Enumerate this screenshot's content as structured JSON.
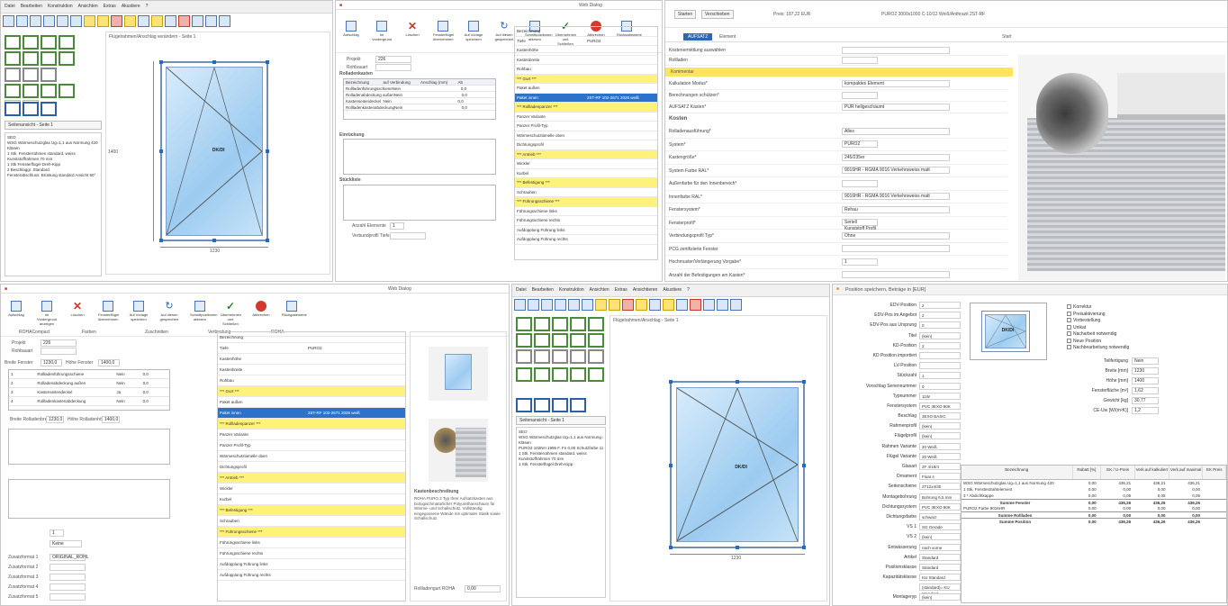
{
  "p1": {
    "menu": [
      "Datei",
      "Bearbeiten",
      "Konstruktion",
      "Ansichten",
      "Extras",
      "Akustiere",
      "?"
    ],
    "preview_caption": "Flügelrahmen/Anschlag verändern - Seite 1",
    "element_label": "DK/DI",
    "nav_label": "Seitenansicht - Seite 1",
    "notes": [
      "SEO",
      "WSG Wärmeschutzglas Ug=1,1 aus Normung 420",
      "Kläsen",
      "1 Stk. Fensterrahmen standard, weiss",
      "Kunststoffrahmen 70 mm",
      "1 Stk Fensterflügel Dreh-Kipp",
      "2 Beschlaggr. Standard",
      "Fensterabschluss: Brüstung standard Ansicht 90°"
    ],
    "dimension_width": "1230",
    "dimension_height": "1400",
    "status_text": "Ohne Vorschau"
  },
  "p2": {
    "title": "Web Dialog",
    "ribbon": [
      "Aufschlag",
      "Im Vordergrund",
      "Löschen",
      "Fensterflügel übernehmen",
      "Auf Vorlage speichern",
      "Auf diesen gespeichert",
      "Schnittpositionen ablesen",
      "Übernehmen und Schließen",
      "Abbrechen",
      "Rückgabewerte"
    ],
    "fields": [
      {
        "label": "Projekt",
        "value": "226"
      },
      {
        "label": "Rohbauart",
        "value": ""
      }
    ],
    "section_rolladen": "Rolladenkasten",
    "table_headers": [
      "Bezeichnung",
      "auf Verbindung",
      "Anschlag (mm)",
      "Ab"
    ],
    "table_rows": [
      [
        "Rollladenführungsschiene",
        "Nein",
        "",
        "0,0"
      ],
      [
        "Rolladenabdeckung außen",
        "Nein",
        "",
        "0,0"
      ],
      [
        "Kastenseitendeckel",
        "Nein",
        "",
        "0,0"
      ],
      [
        "Rollladenkastenabdeckung",
        "Nein",
        "",
        "0,0"
      ]
    ],
    "section_einrueckung": "Einrückung",
    "section_stueckliste": "Stückliste",
    "anzahl_label": "Anzahl Elemente",
    "anzahl_value": "1",
    "profile_label": "Verbundprofil Tiefe",
    "prop_rows": [
      "Bezeichnung",
      "Tiefe",
      "Kastenhöhe",
      "Kastenbreite",
      "Rohbau",
      "*** Gurt ***",
      "Paket außen",
      "Paket innen",
      "*** Rollladenpanzer ***",
      "Panzer Variante",
      "Panzer Profil-Typ",
      "Wärmeschutzlamelle oben",
      "Dichtungsprofil",
      "*** Antrieb ***",
      "Wickler",
      "Kurbel",
      "*** Befestigung ***",
      "Schrauben",
      "*** Führungsschiene ***",
      "Führungsschiene links",
      "Führungsschiene rechts",
      "Aufdopplung Führung links",
      "Aufdopplung Führung rechts"
    ],
    "prop_values": [
      "",
      "PURO2",
      "",
      "",
      "",
      "",
      "",
      "2ST-RF 102-2671 2026 weiß",
      "",
      "",
      "",
      "",
      "",
      "",
      "",
      "",
      "",
      "",
      "",
      "",
      "",
      "",
      ""
    ]
  },
  "p3": {
    "toolbar": [
      "Starten",
      "Verschieben",
      "Preis: 187,22 EUR"
    ],
    "header_info": "PURO2 3000x1000 C-10/12 Weiß/Anthrazit 2ST-RF",
    "tabs": [
      "AUFSATZ",
      "Element"
    ],
    "toolbar_right": [
      "Start"
    ],
    "top_fields": [
      {
        "label": "Kostenermittlung auswählen",
        "value": ""
      },
      {
        "label": "Rollladen",
        "value": ""
      }
    ],
    "highlight_text": "Kommentar",
    "rows": [
      {
        "label": "Kalkulation Modus*",
        "value": "kompaktes Element"
      },
      {
        "label": "Berechnungen schützen*",
        "value": ""
      },
      {
        "label": "AUFSATZ Kasten*",
        "value": "PUR hellgeschäumt"
      }
    ],
    "section": "Kosten",
    "rows2": [
      {
        "label": "Rolladenausführung*",
        "value": "Alles"
      },
      {
        "label": "System*",
        "value": "PURO2"
      },
      {
        "label": "Kastengröße*",
        "value": "245/235er"
      },
      {
        "label": "System Farbe RAL*",
        "value": "9016HR - RGMA 9016 Verkehrsweiss matt"
      },
      {
        "label": "Außenfarbe für den Innenbereich*",
        "value": ""
      },
      {
        "label": "Innenfarbe RAL*",
        "value": "9016HR - RGMA 9016 Verkehrsweiss matt"
      },
      {
        "label": "Fenstersystem*",
        "value": "Rehau"
      },
      {
        "label": "Fensterprofil*",
        "value": "Seriell Kunststoff Profil"
      },
      {
        "label": "Verbindungsprofil Typ*",
        "value": "Ohne"
      },
      {
        "label": "PCG zertifizierte Fenster",
        "value": ""
      },
      {
        "label": "Hochmuster/Verlängerung Vorgabe*",
        "value": "1"
      },
      {
        "label": "Anzahl der Befestigungen am Kasten*",
        "value": ""
      }
    ]
  },
  "p4": {
    "title": "Web Dialog",
    "ribbon": [
      "Aufschlag",
      "Im Vordergrund anzeigen",
      "Löschen",
      "Fensterflügel übernehmen",
      "Auf Vorlage speichern",
      "Auf diesen gespeichert",
      "Schnittpositionen ablesen",
      "Übernehmen und Schließen",
      "Abbrechen",
      "Rückgabewerte"
    ],
    "groups": [
      "ROHACompact",
      "Farben",
      "Zuschnitten",
      "Verbindung",
      "ROHA"
    ],
    "fields": [
      {
        "label": "Projekt",
        "value": "226"
      },
      {
        "label": "Rohbauart",
        "value": ""
      }
    ],
    "breite_label": "Breite Fenster",
    "breite_value": "1230,0",
    "hoehe_label": "Höhe Fenster",
    "hoehe_value": "1400,0",
    "table_rows": [
      [
        "1",
        "Rollladenführungsschiene",
        "Nein",
        "0,0"
      ],
      [
        "2",
        "Rolladenabdeckung außen",
        "Nein",
        "0,0"
      ],
      [
        "3",
        "Kastenseitendeckel",
        "Ja",
        "0,0"
      ],
      [
        "4",
        "Rollladenkastenabdeckung",
        "Nein",
        "0,0"
      ]
    ],
    "bottom_labels": [
      "Breite Rolladenbreite",
      "Höhe Rolladenhöhe"
    ],
    "bottom_values": [
      "1230,0",
      "1400,0"
    ],
    "anzahl_value": "1",
    "profile_value": "Keine",
    "zusatz_rows": [
      "Zusatzformat 1",
      "Zusatzformat 2",
      "Zusatzformat 3",
      "Zusatzformat 4",
      "Zusatzformat 5"
    ],
    "zusatz_first_value": "ORIGINAL_ROHL",
    "preview_text_title": "Kastenbeschreibung",
    "preview_text": "ROHA PURO 2 Typ Ihrer Aufsatzkasten aus biologisch/natürlicher Polyurethanschaum für Wärme- und Schallschutz. Vollständig eingegossene Wände mit optimaler Statik sowie Schallschutz.",
    "price_label": "Rollladengurt ROHA",
    "price_value": "0,00"
  },
  "p5": {
    "menu": [
      "Datei",
      "Bearbeiten",
      "Konstruktion",
      "Ansichten",
      "Extras",
      "Ansichtieren",
      "Akustiere",
      "?"
    ],
    "preview_caption": "Flügelrahmen/Anschlag - Seite 1",
    "element_label": "DK/DI",
    "nav_label": "Seitenansicht - Seite 1",
    "notes": [
      "SEO",
      "WSG Wärmeschutzglas Ug=1,1 aus Normung 420",
      "Kläsen",
      "PURO2 102NH 1996 F. Fn 0,00 Schutzfarbe 1230x1400",
      "1 Stk. Fensterrahmen standard, weiss",
      "Kunststoffrahmen 70 mm",
      "1 Stk. Fensterflügel Dreh-Kipp"
    ],
    "dimension_width": "1230",
    "status_text": "Ohne Vorschau"
  },
  "p6": {
    "title": "Position speichern, Beträge in [EUR]",
    "fields": [
      {
        "label": "EDV-Position",
        "value": "2"
      },
      {
        "label": "EDV-Pos im Angebot",
        "value": "2"
      },
      {
        "label": "EDV-Pos aus Ursprung",
        "value": "0"
      },
      {
        "label": "Titel",
        "value": "(kein)"
      },
      {
        "label": "KD-Position",
        "value": "2"
      },
      {
        "label": "KD Position importiert",
        "value": ""
      },
      {
        "label": "LV-Position",
        "value": ""
      },
      {
        "label": "Stückzahl",
        "value": "1"
      },
      {
        "label": "Vorschlag Seriennummer",
        "value": "0"
      },
      {
        "label": "Typnummer",
        "value": "11W"
      },
      {
        "label": "Fenstersystem",
        "value": "PVC 3EXO 80K"
      },
      {
        "label": "Beschlag",
        "value": "3EXO BASIC"
      },
      {
        "label": "Rahmenprofil",
        "value": "(kein)"
      },
      {
        "label": "Flügelprofil",
        "value": "(kein)"
      },
      {
        "label": "Rahmen Variante",
        "value": "20 Weiß"
      },
      {
        "label": "Flügel Variante",
        "value": "20 Weiß"
      },
      {
        "label": "Glasart",
        "value": "2F 4/18/4"
      },
      {
        "label": "Ornament",
        "value": "Float 4"
      },
      {
        "label": "Seitenschiene",
        "value": "2T12x4/30"
      },
      {
        "label": "Montagebohrung",
        "value": "Bohrung 6,5 mm"
      },
      {
        "label": "Dichtungssystem",
        "value": "PVC 3EXO 80K"
      },
      {
        "label": "Dichtungsfarbe",
        "value": "schwarz"
      },
      {
        "label": "VS 1",
        "value": "SG Gerade"
      },
      {
        "label": "VS 2",
        "value": "(kein)"
      },
      {
        "label": "Entwässerung",
        "value": "nach vorne"
      },
      {
        "label": "Artikel",
        "value": "Standard"
      },
      {
        "label": "Positionsklasse",
        "value": "Standard"
      },
      {
        "label": "Kapazitätsklasse",
        "value": "KU Standard"
      },
      {
        "label": "",
        "value": "(standard)= KU Standard"
      },
      {
        "label": "Montageryp",
        "value": "(kein)"
      }
    ],
    "element_label": "DK/DI",
    "checkboxes": [
      "Korrektur",
      "Preisaktivierung",
      "Vorbestellung",
      "Unikat",
      "Nacharbeit notwendig",
      "Neue Position",
      "Nachbearbeitung notwendig"
    ],
    "right_fields": [
      {
        "label": "Teilfertigung",
        "value": "Nein"
      },
      {
        "label": "Breite [mm]",
        "value": "1230"
      },
      {
        "label": "Höhe [mm]",
        "value": "1400"
      },
      {
        "label": "Fensterfläche [m²]",
        "value": "1,62"
      },
      {
        "label": "Gewicht [kg]",
        "value": "30,77"
      },
      {
        "label": "CE-Uw [W/(m²K)]",
        "value": "1,2"
      }
    ],
    "table_headers": [
      "Bezeichnung",
      "Rabatt [%]",
      "EK / U-Preis",
      "Verk.auf kalkuliert",
      "Verk.auf maximal",
      "EK Preis"
    ],
    "table_rows": [
      [
        "WSG Wärmeschutzglas Ug=1,1 aus Normung 420",
        "0,00",
        "436,21",
        "436,21",
        "436,21",
        ""
      ],
      [
        "1 Stk. Fensterdrahtelement",
        "0,00",
        "0,00",
        "0,00",
        "0,00",
        ""
      ],
      [
        "3 * Abdichtkappe",
        "0,00",
        "0,05",
        "0,05",
        "0,05",
        ""
      ],
      [
        "Summe Fenster",
        "0,00",
        "436,26",
        "436,26",
        "436,26",
        ""
      ],
      [
        "PURO2 Farbe 9016HR",
        "0,00",
        "0,00",
        "0,00",
        "0,00",
        ""
      ],
      [
        "Summe Rollladen",
        "0,00",
        "0,00",
        "0,00",
        "0,00",
        ""
      ],
      [
        "Summe Position",
        "0,00",
        "436,26",
        "436,26",
        "436,26",
        ""
      ]
    ]
  }
}
